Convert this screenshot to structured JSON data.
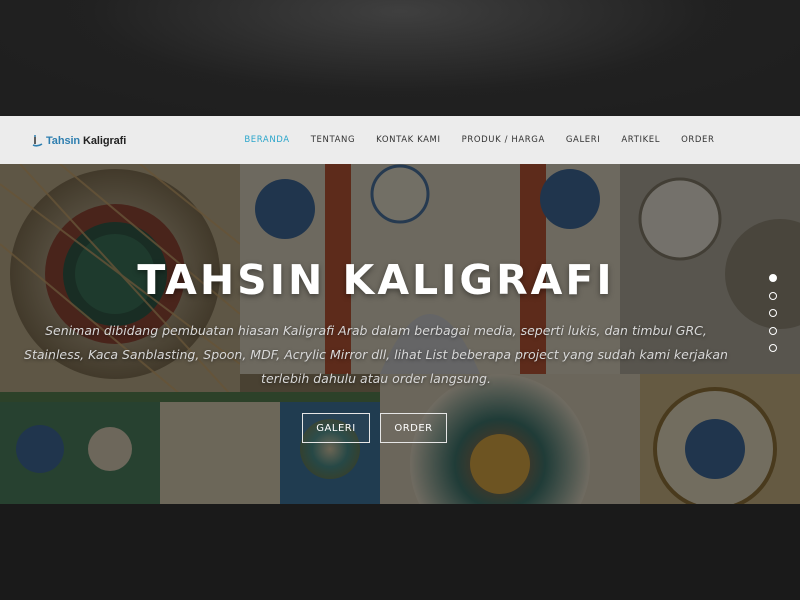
{
  "brand": {
    "name_part1": "Tahsin",
    "name_part2": "Kaligrafi"
  },
  "nav": {
    "items": [
      {
        "label": "BERANDA",
        "active": true
      },
      {
        "label": "TENTANG",
        "active": false
      },
      {
        "label": "KONTAK KAMI",
        "active": false
      },
      {
        "label": "PRODUK / HARGA",
        "active": false
      },
      {
        "label": "GALERI",
        "active": false
      },
      {
        "label": "ARTIKEL",
        "active": false
      },
      {
        "label": "ORDER",
        "active": false
      }
    ]
  },
  "hero": {
    "title": "TAHSIN KALIGRAFI",
    "description": "Seniman dibidang pembuatan hiasan Kaligrafi Arab dalam berbagai media, seperti lukis, dan timbul GRC, Stainless, Kaca Sanblasting, Spoon, MDF, Acrylic Mirror dll, lihat List beberapa project yang sudah kami kerjakan terlebih dahulu atau order langsung.",
    "buttons": {
      "galeri": "GALERI",
      "order": "ORDER"
    },
    "slider": {
      "total": 5,
      "active_index": 0
    }
  },
  "colors": {
    "accent": "#2ba6cb",
    "logo_blue": "#2f7fb0",
    "navbar_bg": "#ececec"
  }
}
